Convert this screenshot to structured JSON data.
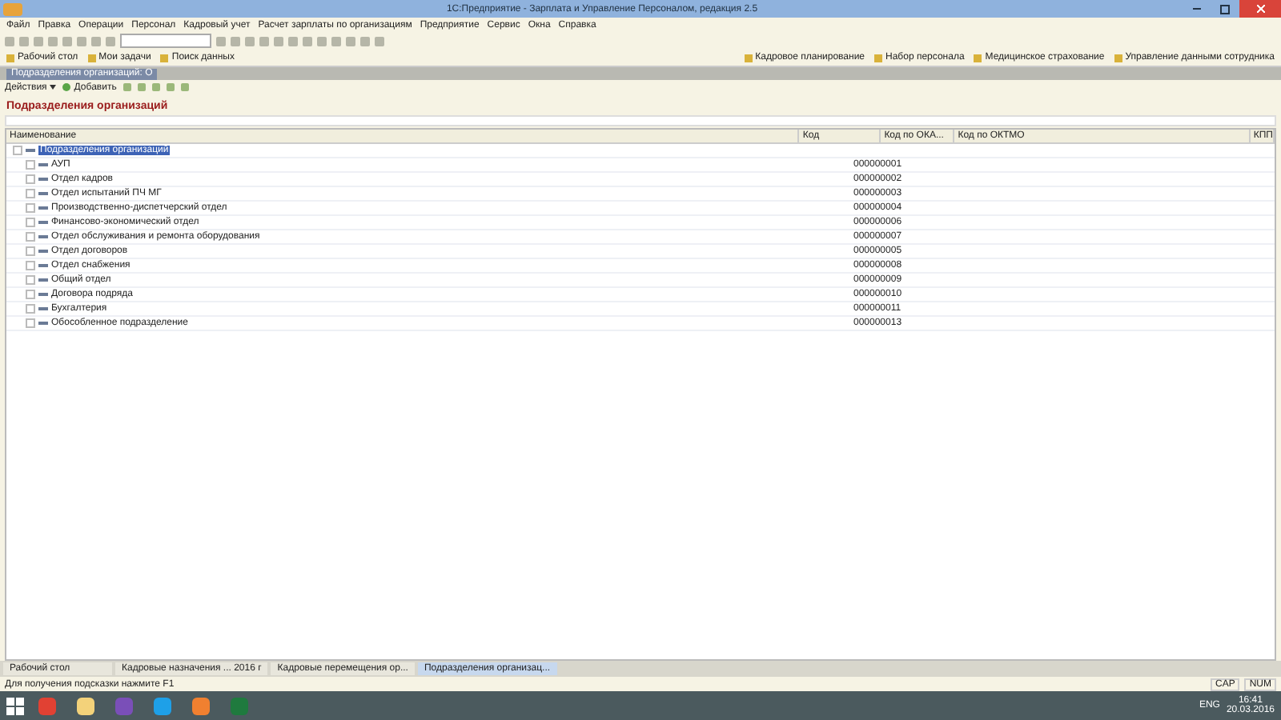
{
  "window": {
    "title": "1С:Предприятие - Зарплата и Управление Персоналом, редакция 2.5"
  },
  "menu": [
    "Файл",
    "Правка",
    "Операции",
    "Персонал",
    "Кадровый учет",
    "Расчет зарплаты по организациям",
    "Предприятие",
    "Сервис",
    "Окна",
    "Справка"
  ],
  "panel": {
    "left": [
      "Рабочий стол",
      "Мои задачи",
      "Поиск данных"
    ],
    "right": [
      "Кадровое планирование",
      "Набор персонала",
      "Медицинское страхование",
      "Управление данными сотрудника"
    ]
  },
  "form": {
    "tab_title": "Подразделения организаций: О",
    "actions": [
      "Действия",
      "Добавить"
    ],
    "heading": "Подразделения организаций"
  },
  "table": {
    "columns": [
      "Наименование",
      "Код",
      "Код по ОКА...",
      "Код по ОКТМО",
      "КПП"
    ],
    "root": {
      "name": "Подразделения организаций",
      "selected": true,
      "children": [
        {
          "name": "АУП",
          "code": "000000001"
        },
        {
          "name": "Отдел кадров",
          "code": "000000002"
        },
        {
          "name": "Отдел испытаний ПЧ МГ",
          "code": "000000003"
        },
        {
          "name": "Производственно-диспетчерский отдел",
          "code": "000000004"
        },
        {
          "name": "Финансово-экономический отдел",
          "code": "000000006"
        },
        {
          "name": "Отдел обслуживания и ремонта оборудования",
          "code": "000000007"
        },
        {
          "name": "Отдел договоров",
          "code": "000000005"
        },
        {
          "name": "Отдел снабжения",
          "code": "000000008"
        },
        {
          "name": "Общий отдел",
          "code": "000000009"
        },
        {
          "name": "Договора подряда",
          "code": "000000010"
        },
        {
          "name": "Бухгалтерия",
          "code": "000000011"
        },
        {
          "name": "Обособленное подразделение",
          "code": "000000013"
        }
      ]
    }
  },
  "window_tabs": [
    {
      "label": "Рабочий стол",
      "selected": false
    },
    {
      "label": "Кадровые назначения ... 2016 г",
      "selected": false
    },
    {
      "label": "Кадровые перемещения ор...",
      "selected": false
    },
    {
      "label": "Подразделения организац...",
      "selected": true
    }
  ],
  "status_bar": {
    "hint": "Для получения подсказки нажмите F1",
    "indicators": [
      "CAP",
      "NUM"
    ]
  },
  "taskbar": {
    "language": "ENG",
    "time": "16:41",
    "date": "20.03.2016"
  }
}
